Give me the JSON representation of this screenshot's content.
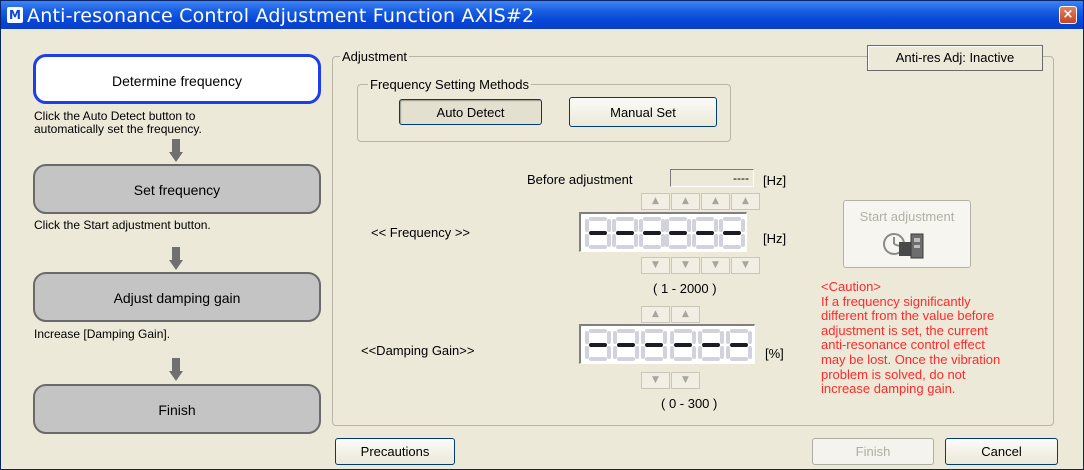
{
  "window": {
    "title": "Anti-resonance Control Adjustment Function AXIS#2",
    "icon_glyph": "M",
    "close_glyph": "×"
  },
  "steps": [
    {
      "label": "Determine frequency",
      "hint_lines": [
        "Click the Auto Detect button to",
        "automatically set the frequency."
      ]
    },
    {
      "label": "Set frequency",
      "hint_lines": [
        "Click the Start adjustment button."
      ]
    },
    {
      "label": "Adjust damping gain",
      "hint_lines": [
        "Increase [Damping Gain]."
      ]
    },
    {
      "label": "Finish",
      "hint_lines": []
    }
  ],
  "adjustment": {
    "group_label": "Adjustment",
    "status": "Anti-res Adj: Inactive",
    "methods": {
      "group_label": "Frequency Setting Methods",
      "auto_detect": "Auto Detect",
      "manual_set": "Manual Set"
    },
    "before_adjustment_label": "Before adjustment",
    "before_adjustment_value": "----",
    "hz_unit": "[Hz]",
    "frequency": {
      "label": "<< Frequency >>",
      "unit": "[Hz]",
      "range": "( 1 - 2000 )",
      "display": "------"
    },
    "damping_gain": {
      "label": "<<Damping Gain>>",
      "unit": "[%]",
      "range": "( 0 - 300 )",
      "display": "------"
    },
    "start_adjustment": "Start adjustment",
    "caution_title": "<Caution>",
    "caution_lines": [
      "If a frequency significantly",
      "different from the value before",
      "adjustment is set, the current",
      "anti-resonance control effect",
      "may be lost. Once the vibration",
      "problem is solved, do not",
      "increase damping gain."
    ],
    "up_glyph": "▲",
    "down_glyph": "▼"
  },
  "footer": {
    "precautions": "Precautions",
    "finish": "Finish",
    "cancel": "Cancel"
  },
  "colors": {
    "titlebar": "#0a46d8",
    "active_step_border": "#1e3ee8",
    "caution_text": "#ff2a2a",
    "window_bg": "#ece9d8"
  }
}
